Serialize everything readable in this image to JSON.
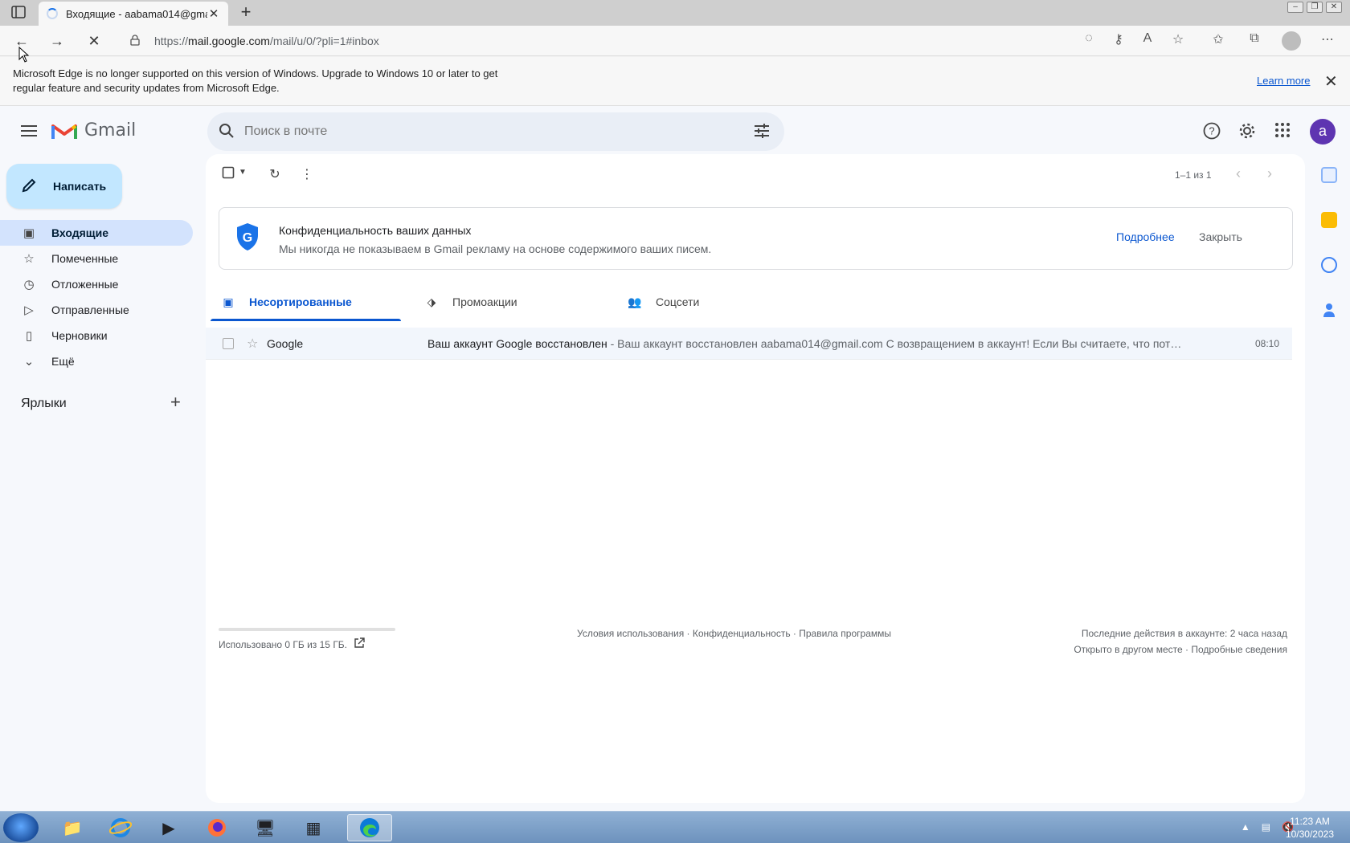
{
  "browser": {
    "tab_title": "Входящие - aabama014@gmail.com",
    "url_prefix": "https://",
    "url_host": "mail.google.com",
    "url_path": "/mail/u/0/?pli=1#inbox"
  },
  "infobar": {
    "message": "Microsoft Edge is no longer supported on this version of Windows. Upgrade to Windows 10 or later to get regular feature and security updates from Microsoft Edge.",
    "learn_more": "Learn more"
  },
  "gmail": {
    "logo_text": "Gmail",
    "search_placeholder": "Поиск в почте",
    "avatar_letter": "a",
    "compose_label": "Написать",
    "nav": [
      {
        "label": "Входящие",
        "icon": "inbox-icon"
      },
      {
        "label": "Помеченные",
        "icon": "star-icon"
      },
      {
        "label": "Отложенные",
        "icon": "clock-icon"
      },
      {
        "label": "Отправленные",
        "icon": "send-icon"
      },
      {
        "label": "Черновики",
        "icon": "draft-icon"
      },
      {
        "label": "Ещё",
        "icon": "chevron-down-icon"
      }
    ],
    "labels_header": "Ярлыки",
    "pager": "1–1 из 1",
    "banner": {
      "title": "Конфиденциальность ваших данных",
      "text": "Мы никогда не показываем в Gmail рекламу на основе содержимого ваших писем.",
      "more": "Подробнее",
      "close": "Закрыть"
    },
    "tabs": [
      {
        "label": "Несортированные"
      },
      {
        "label": "Промоакции"
      },
      {
        "label": "Соцсети"
      }
    ],
    "emails": [
      {
        "sender": "Google",
        "subject": "Ваш аккаунт Google восстановлен",
        "snippet": " - Ваш аккаунт восстановлен aabama014@gmail.com С возвращением в аккаунт! Если Вы считаете, что пот…",
        "time": "08:10"
      }
    ],
    "footer": {
      "storage": "Использовано 0 ГБ из 15 ГБ.",
      "storage_used_fraction": 0,
      "links": "Условия использования · Конфиденциальность · Правила программы",
      "activity": "Последние действия в аккаунте: 2 часа назад",
      "details": "Открыто в другом месте · Подробные сведения"
    }
  },
  "taskbar": {
    "time": "11:23 AM",
    "date": "10/30/2023"
  },
  "colors": {
    "accent": "#0b57d0",
    "compose": "#c2e7ff",
    "active_nav": "#d3e3fd",
    "avatar": "#5e35b1"
  }
}
